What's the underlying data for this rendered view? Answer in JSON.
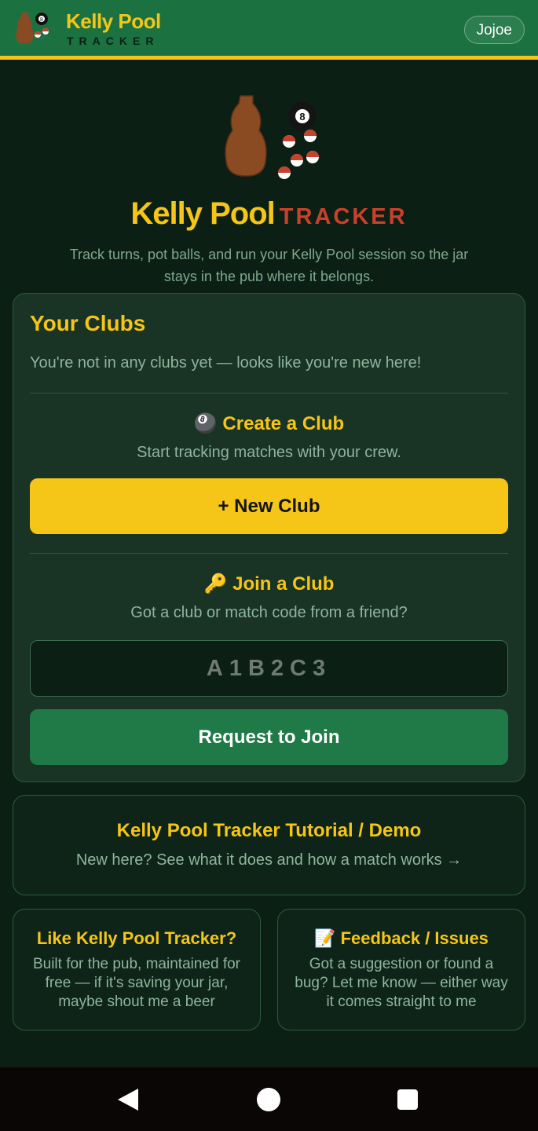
{
  "header": {
    "logo_ball_number": "8",
    "brand_title": "Kelly Pool",
    "brand_subtitle": "TRACKER",
    "user_name": "Jojoe"
  },
  "hero": {
    "logo_ball_number": "8",
    "title_primary": "Kelly Pool",
    "title_secondary": "TRACKER",
    "tagline": "Track turns, pot balls, and run your Kelly Pool session so the jar stays in the pub where it belongs."
  },
  "clubs": {
    "title": "Your Clubs",
    "empty_message": "You're not in any clubs yet — looks like you're new here!",
    "create": {
      "icon_glyph": "🎱",
      "title": "Create a Club",
      "subtitle": "Start tracking matches with your crew.",
      "button_label": "+ New Club"
    },
    "join": {
      "icon_glyph": "🔑",
      "title": "Join a Club",
      "subtitle": "Got a club or match code from a friend?",
      "code_placeholder": "A1B2C3",
      "code_value": "",
      "button_label": "Request to Join"
    }
  },
  "tutorial": {
    "title": "Kelly Pool Tracker Tutorial / Demo",
    "subtitle": "New here? See what it does and how a match works →"
  },
  "support": {
    "title": "Like Kelly Pool Tracker?",
    "body": "Built for the pub, maintained for free — if it's saving your jar, maybe shout me a beer"
  },
  "feedback": {
    "icon_glyph": "📝",
    "title": "Feedback / Issues",
    "body": "Got a suggestion or found a bug? Let me know — either way it comes straight to me"
  },
  "colors": {
    "header_green": "#1b7240",
    "accent_yellow": "#f5c518",
    "accent_red": "#c9402b",
    "background": "#0c1f15",
    "card": "#193324",
    "button_green": "#1f7a47"
  },
  "icons": {
    "logo": "jar-and-pool-balls-icon",
    "nav_back": "back-triangle-icon",
    "nav_home": "home-circle-icon",
    "nav_recents": "recents-square-icon"
  }
}
